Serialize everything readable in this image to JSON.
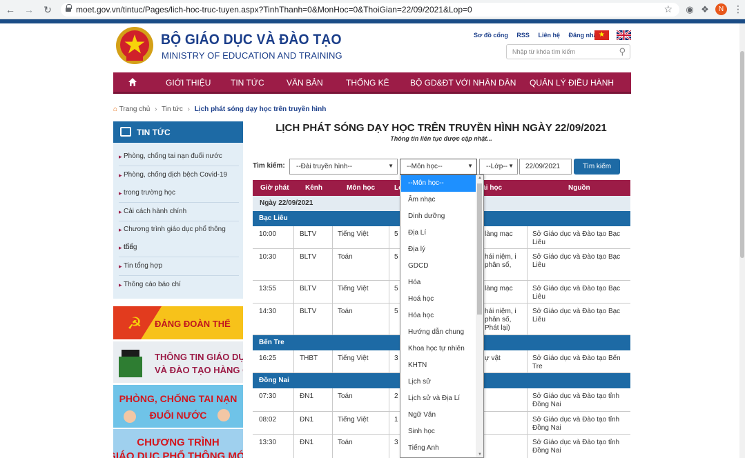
{
  "browser": {
    "url": "moet.gov.vn/tintuc/Pages/lich-hoc-truc-tuyen.aspx?TinhThanh=0&MonHoc=0&ThoiGian=22/09/2021&Lop=0",
    "profile_initial": "N"
  },
  "header": {
    "title": "BỘ GIÁO DỤC VÀ ĐÀO TẠO",
    "subtitle": "MINISTRY OF EDUCATION AND TRAINING",
    "links": [
      "Sơ đồ cổng",
      "RSS",
      "Liên hệ",
      "Đăng nhập"
    ],
    "search_placeholder": "Nhập từ khóa tìm kiếm"
  },
  "nav": {
    "items": [
      "GIỚI THIỆU",
      "TIN TỨC",
      "VĂN BẢN",
      "THỐNG KÊ",
      "BỘ GD&ĐT VỚI NHÂN DÂN",
      "QUẢN LÝ ĐIỀU HÀNH"
    ]
  },
  "breadcrumb": [
    "Trang chủ",
    "Tin tức",
    "Lịch phát sóng dạy học trên truyền hình"
  ],
  "sidebar": {
    "title": "TIN TỨC",
    "items": [
      "Phòng, chống tai nạn đuối nước",
      "Phòng, chống dịch bệch Covid-19",
      "trong trường học",
      "Cải cách hành chính",
      "Chương trình giáo dục phổ thông tổng",
      "thể",
      "Tin tổng hợp",
      "Thông cáo báo chí"
    ],
    "banners": [
      {
        "text": "ĐẢNG ĐOÀN THỂ"
      },
      {
        "line1": "THÔNG TIN GIÁO DỤC",
        "line2": "VÀ ĐÀO TẠO HÀNG QUÝ"
      },
      {
        "line1": "PHÒNG, CHỐNG TAI NẠN",
        "line2": "ĐUỐI NƯỚC"
      },
      {
        "line1": "CHƯƠNG TRÌNH",
        "line2": "GIÁO DỤC PHỔ THÔNG MỚI"
      }
    ]
  },
  "content": {
    "heading": "LỊCH PHÁT SÓNG DẠY HỌC TRÊN TRUYỀN HÌNH NGÀY 22/09/2021",
    "subheading": "Thông tin liên tục được cập nhật...",
    "search": {
      "label": "Tìm kiếm:",
      "station": "--Đài truyền hình--",
      "subject": "--Môn học--",
      "grade": "--Lớp--",
      "date": "22/09/2021",
      "button": "Tìm kiếm"
    },
    "table": {
      "headers": [
        "Giờ phát",
        "Kênh",
        "Môn học",
        "Lớp",
        "Bài học",
        "Nguồn"
      ],
      "date_label": "Ngày 22/09/2021",
      "groups": [
        {
          "province": "Bạc Liêu",
          "rows": [
            {
              "time": "10:00",
              "channel": "BLTV",
              "subject": "Tiếng Việt",
              "grade": "5",
              "lesson": "làng mạc",
              "source": "Sở Giáo dục và Đào tạo Bạc Liêu"
            },
            {
              "time": "10:30",
              "channel": "BLTV",
              "subject": "Toán",
              "grade": "5",
              "lesson": "hái niệm, i phân số,",
              "source": "Sở Giáo dục và Đào tạo Bạc Liêu"
            },
            {
              "time": "13:55",
              "channel": "BLTV",
              "subject": "Tiếng Việt",
              "grade": "5",
              "lesson": "làng mạc",
              "source": "Sở Giáo dục và Đào tạo Bạc Liêu"
            },
            {
              "time": "14:30",
              "channel": "BLTV",
              "subject": "Toán",
              "grade": "5",
              "lesson": "hái niệm, i phân số, Phát lại)",
              "source": "Sở Giáo dục và Đào tạo Bạc Liêu"
            }
          ]
        },
        {
          "province": "Bến Tre",
          "rows": [
            {
              "time": "16:25",
              "channel": "THBT",
              "subject": "Tiếng Việt",
              "grade": "3",
              "lesson": "ự vật",
              "source": "Sở Giáo dục và Đào tạo Bến Tre"
            }
          ]
        },
        {
          "province": "Đồng Nai",
          "rows": [
            {
              "time": "07:30",
              "channel": "ĐN1",
              "subject": "Toán",
              "grade": "2",
              "lesson": "",
              "source": "Sở Giáo dục và Đào tạo tỉnh Đồng Nai"
            },
            {
              "time": "08:02",
              "channel": "ĐN1",
              "subject": "Tiếng Việt",
              "grade": "1",
              "lesson": "",
              "source": "Sở Giáo dục và Đào tạo tỉnh Đồng Nai"
            },
            {
              "time": "13:30",
              "channel": "ĐN1",
              "subject": "Toán",
              "grade": "3",
              "lesson": "",
              "source": "Sở Giáo dục và Đào tạo tỉnh Đồng Nai"
            }
          ]
        }
      ]
    },
    "dropdown_options": [
      "--Môn học--",
      "Âm nhạc",
      "Dinh dưỡng",
      "Địa Lí",
      "Địa lý",
      "GDCD",
      "Hóa",
      "Hoá học",
      "Hóa học",
      "Hướng dẫn chung",
      "Khoa học tự nhiên",
      "KHTN",
      "Lịch sử",
      "Lịch sử và Địa Lí",
      "Ngữ Văn",
      "Sinh học",
      "Tiếng Anh"
    ]
  },
  "colors": {
    "brand_blue": "#1b3e8a",
    "nav_maroon": "#9c1c47",
    "section_blue": "#1d6aa5",
    "dropdown_highlight": "#1e90ff"
  }
}
